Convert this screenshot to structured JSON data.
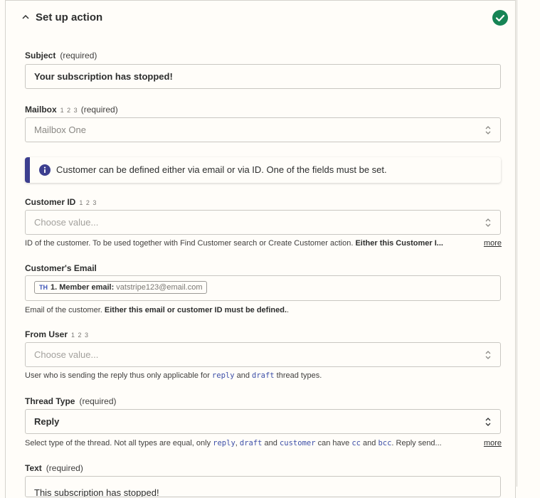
{
  "header": {
    "title": "Set up action",
    "status": "complete"
  },
  "subject": {
    "label": "Subject",
    "required": "(required)",
    "value": "Your subscription has stopped!"
  },
  "mailbox": {
    "label": "Mailbox",
    "nums": "1 2 3",
    "required": "(required)",
    "value": "Mailbox One"
  },
  "info": {
    "text": "Customer can be defined either via email or via ID. One of the fields must be set."
  },
  "customer_id": {
    "label": "Customer ID",
    "nums": "1 2 3",
    "placeholder": "Choose value...",
    "help_plain": "ID of the customer. To be used together with Find Customer search or Create Customer action. ",
    "help_bold": "Either this Customer I...",
    "more": "more"
  },
  "customer_email": {
    "label": "Customer's Email",
    "pill_logo": "TH",
    "pill_label": "1. Member email:",
    "pill_value": "vatstripe123@email.com",
    "help_plain": "Email of the customer. ",
    "help_bold": "Either this email or customer ID must be defined.",
    "help_end": "."
  },
  "from_user": {
    "label": "From User",
    "nums": "1 2 3",
    "placeholder": "Choose value...",
    "help_1": "User who is sending the reply thus only applicable for ",
    "code_1": "reply",
    "help_2": " and ",
    "code_2": "draft",
    "help_3": " thread types."
  },
  "thread_type": {
    "label": "Thread Type",
    "required": "(required)",
    "value": "Reply",
    "help_1": "Select type of the thread. Not all types are equal, only ",
    "code_1": "reply",
    "help_2": ", ",
    "code_2": "draft",
    "help_3": " and ",
    "code_3": "customer",
    "help_4": " can have ",
    "code_4": "cc",
    "help_5": " and ",
    "code_5": "bcc",
    "help_6": ". Reply send...",
    "more": "more"
  },
  "text_field": {
    "label": "Text",
    "required": "(required)",
    "value": "This subscription has stopped!"
  },
  "colors": {
    "accent": "#3d3f8f",
    "success": "#168455",
    "code": "#3d4fa8"
  }
}
